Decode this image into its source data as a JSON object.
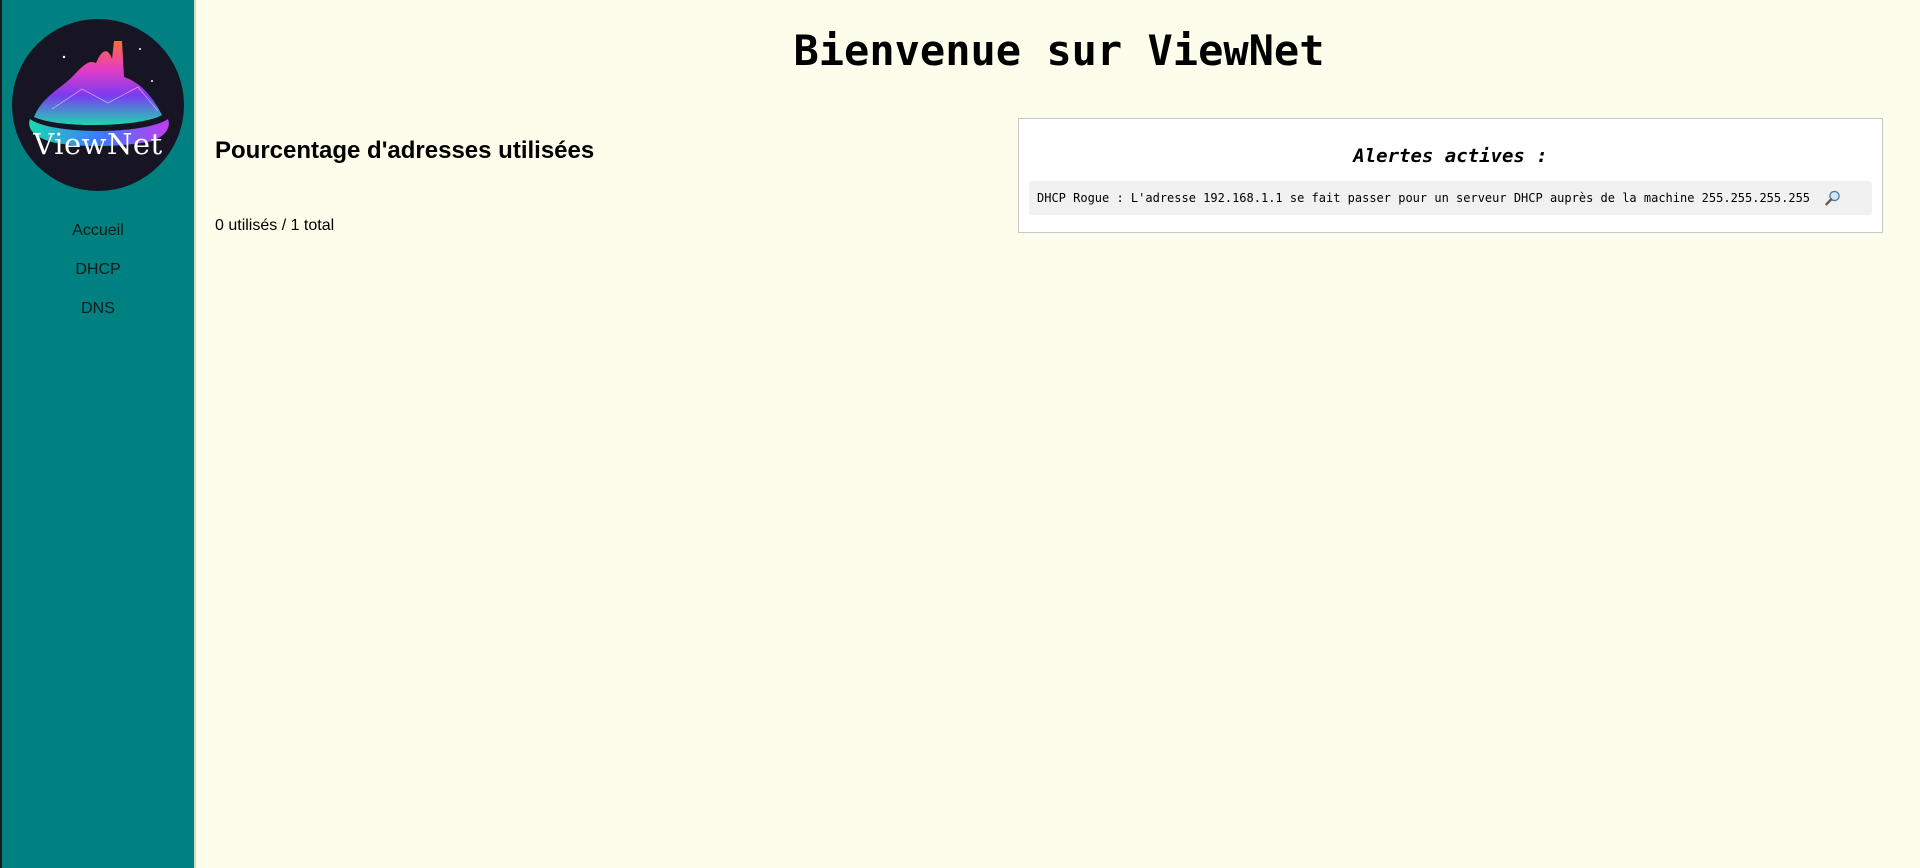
{
  "sidebar": {
    "logo_text": "ViewNet",
    "nav": [
      {
        "label": "Accueil"
      },
      {
        "label": "DHCP"
      },
      {
        "label": "DNS"
      }
    ]
  },
  "header": {
    "title": "Bienvenue sur ViewNet"
  },
  "usage": {
    "title": "Pourcentage d'adresses utilisées",
    "count_text": "0 utilisés / 1 total"
  },
  "alerts": {
    "title": "Alertes actives :",
    "items": [
      {
        "text": "DHCP Rogue : L'adresse 192.168.1.1 se fait passer pour un serveur DHCP auprès de la machine 255.255.255.255",
        "icon": "magnifier-icon"
      }
    ]
  },
  "colors": {
    "sidebar_bg": "#008080",
    "page_bg": "#fdfdeb",
    "panel_bg": "#ffffff",
    "alert_bg": "#f1f1f1"
  }
}
